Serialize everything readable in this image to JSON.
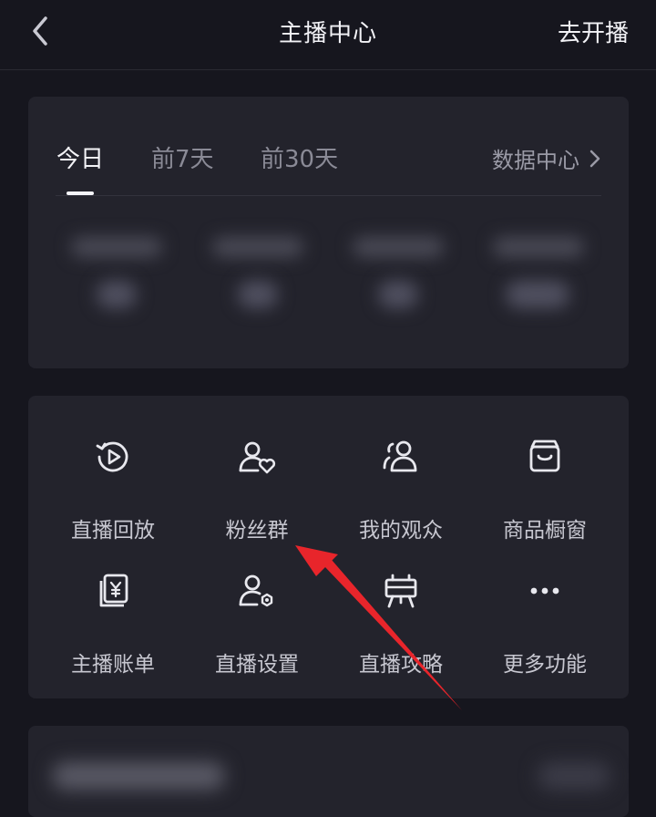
{
  "header": {
    "title": "主播中心",
    "action_label": "去开播"
  },
  "tabs": [
    {
      "label": "今日",
      "active": true
    },
    {
      "label": "前7天",
      "active": false
    },
    {
      "label": "前30天",
      "active": false
    }
  ],
  "data_center_label": "数据中心",
  "features": [
    {
      "label": "直播回放",
      "icon": "replay-icon"
    },
    {
      "label": "粉丝群",
      "icon": "fan-group-icon"
    },
    {
      "label": "我的观众",
      "icon": "audience-icon"
    },
    {
      "label": "商品橱窗",
      "icon": "shop-window-icon"
    },
    {
      "label": "主播账单",
      "icon": "bill-icon"
    },
    {
      "label": "直播设置",
      "icon": "settings-user-icon"
    },
    {
      "label": "直播攻略",
      "icon": "guide-icon"
    },
    {
      "label": "更多功能",
      "icon": "more-icon"
    }
  ],
  "colors": {
    "background": "#16161e",
    "card": "#23232c",
    "arrow": "#e8252b"
  }
}
